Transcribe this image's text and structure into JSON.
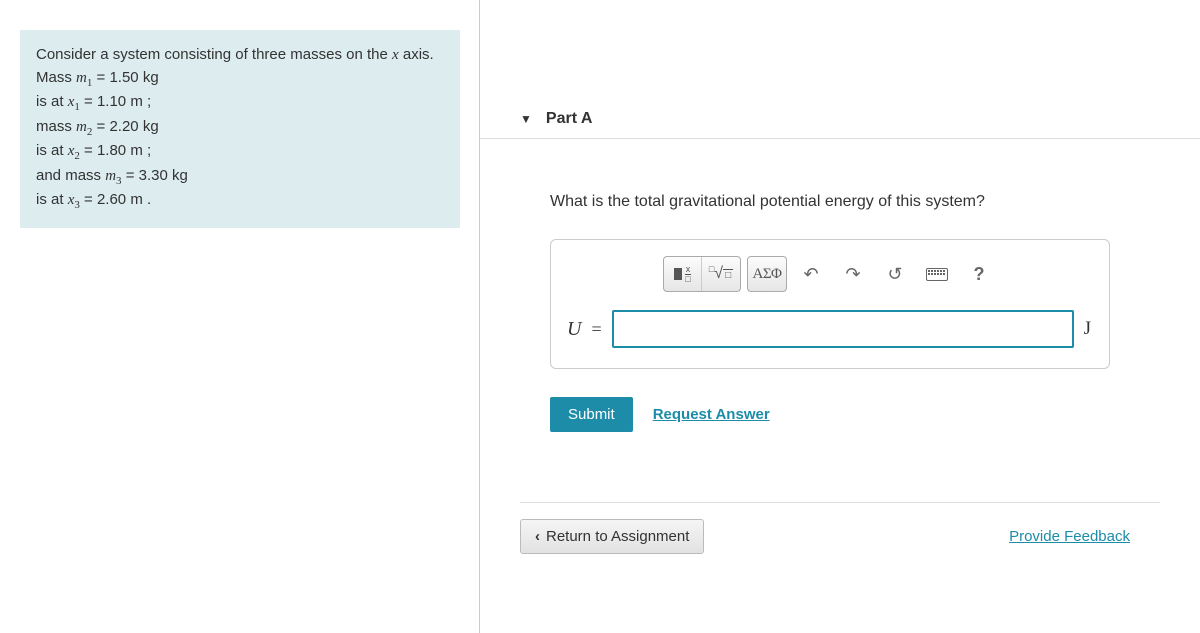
{
  "problem": {
    "intro": "Consider a system consisting of three masses on the ",
    "axis_var": "x",
    "axis_suffix": " axis. Mass ",
    "m1_var": "m",
    "m1_sub": "1",
    "m1_val": " = 1.50 ",
    "kg": "kg",
    "isat1a": "is at ",
    "x1_var": "x",
    "x1_sub": "1",
    "x1_val": " = 1.10 ",
    "m": "m",
    "semi": " ;",
    "mass2": "mass ",
    "m2_var": "m",
    "m2_sub": "2",
    "m2_val": " = 2.20 ",
    "isat2a": "is at ",
    "x2_var": "x",
    "x2_sub": "2",
    "x2_val": " = 1.80 ",
    "and_mass3": "and mass ",
    "m3_var": "m",
    "m3_sub": "3",
    "m3_val": " = 3.30 ",
    "isat3a": "is at ",
    "x3_var": "x",
    "x3_sub": "3",
    "x3_val": " = 2.60 ",
    "period": " ."
  },
  "part": {
    "title": "Part A",
    "question": "What is the total gravitational potential energy of this system?",
    "var_label": "U",
    "eq": "=",
    "unit": "J"
  },
  "toolbar": {
    "greek": "ΑΣΦ",
    "help": "?"
  },
  "actions": {
    "submit": "Submit",
    "request": "Request Answer",
    "return": "Return to Assignment",
    "feedback": "Provide Feedback"
  }
}
